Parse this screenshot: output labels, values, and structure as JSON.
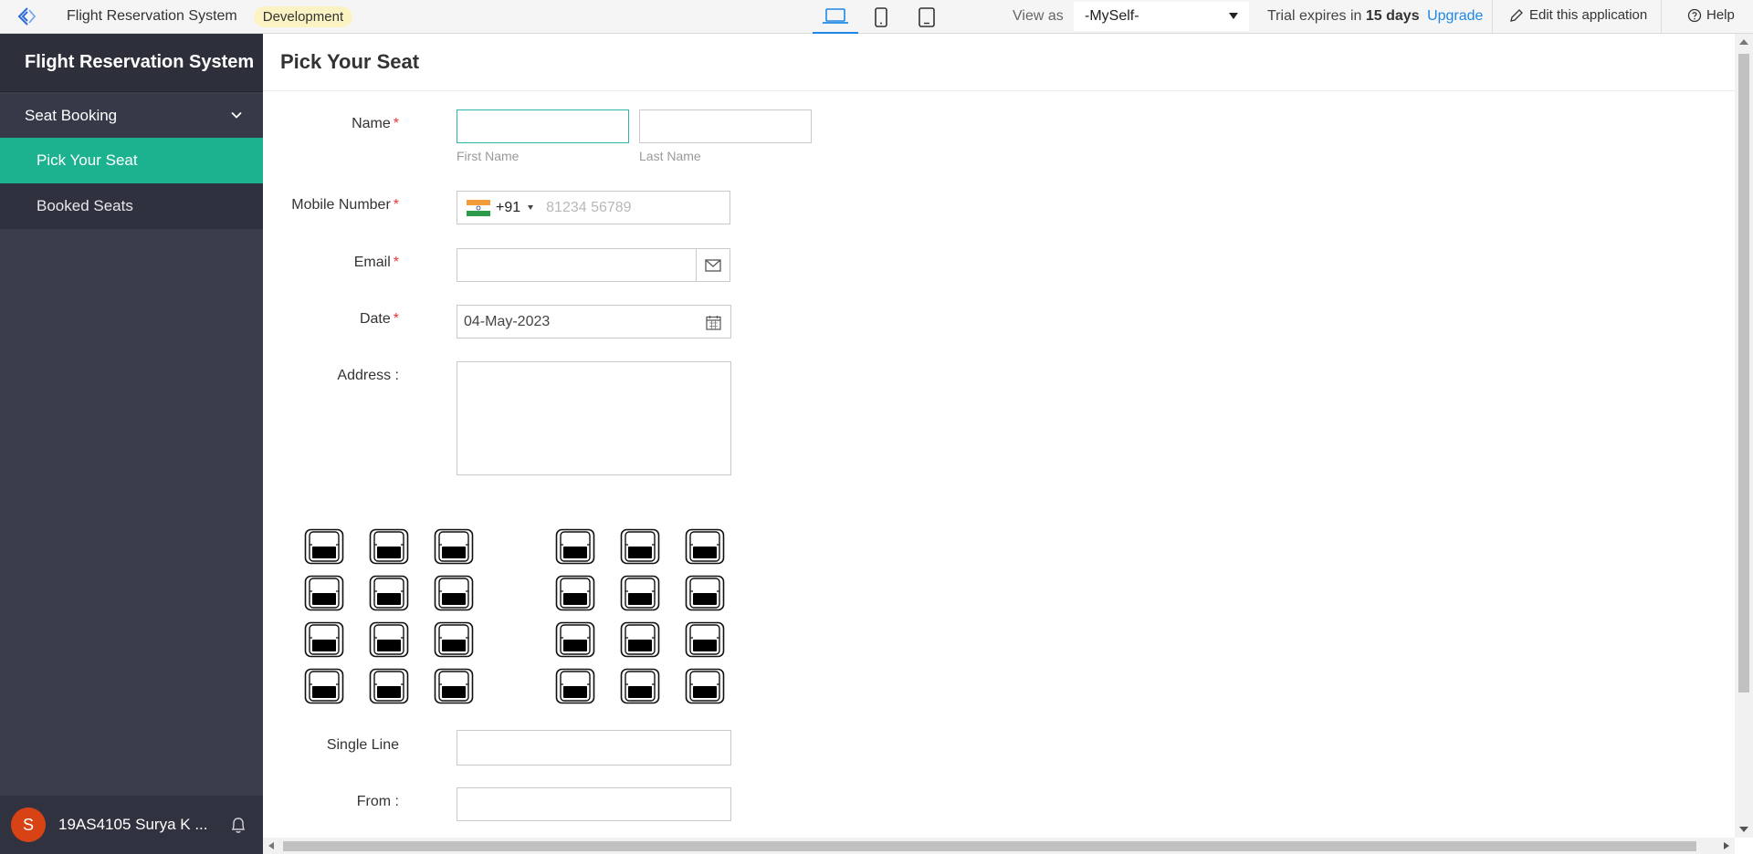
{
  "topbar": {
    "app_name": "Flight Reservation System",
    "env_badge": "Development",
    "devices": [
      "laptop-icon",
      "phone-icon",
      "tablet-icon"
    ],
    "view_as_label": "View as",
    "view_as_value": "-MySelf-",
    "trial_prefix": "Trial expires in",
    "trial_days": "15 days",
    "upgrade_label": "Upgrade",
    "edit_label": "Edit this application",
    "help_label": "Help"
  },
  "sidebar": {
    "title": "Flight Reservation System",
    "group_label": "Seat Booking",
    "items": [
      {
        "label": "Pick Your Seat",
        "active": true
      },
      {
        "label": "Booked Seats",
        "active": false
      }
    ],
    "user_initial": "S",
    "user_name": "19AS4105 Surya K ..."
  },
  "main": {
    "page_title": "Pick Your Seat",
    "form": {
      "name_label": "Name",
      "first_name_hint": "First Name",
      "last_name_hint": "Last Name",
      "mobile_label": "Mobile Number",
      "mobile_code": "+91",
      "mobile_placeholder": "81234 56789",
      "email_label": "Email",
      "date_label": "Date",
      "date_value": "04-May-2023",
      "address_label": "Address :",
      "single_line_label": "Single Line",
      "from_label": "From :"
    },
    "seat_map": {
      "rows": 4,
      "left_columns": 3,
      "right_columns": 3
    }
  },
  "colors": {
    "accent": "#1cb290",
    "sidebar_bg": "#3a3d4a",
    "link": "#1e88e5",
    "badge_bg": "#fcf3c4",
    "required": "#e53935"
  }
}
